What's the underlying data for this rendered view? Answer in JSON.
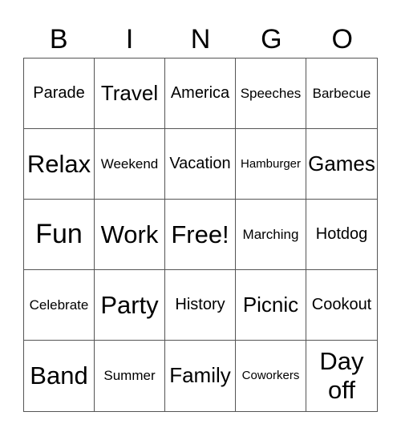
{
  "header": [
    "B",
    "I",
    "N",
    "G",
    "O"
  ],
  "cells": [
    {
      "text": "Parade",
      "size": "m"
    },
    {
      "text": "Travel",
      "size": "l"
    },
    {
      "text": "America",
      "size": "m"
    },
    {
      "text": "Speeches",
      "size": "s"
    },
    {
      "text": "Barbecue",
      "size": "s"
    },
    {
      "text": "Relax",
      "size": "xl"
    },
    {
      "text": "Weekend",
      "size": "s"
    },
    {
      "text": "Vacation",
      "size": "m"
    },
    {
      "text": "Hamburger",
      "size": "xs"
    },
    {
      "text": "Games",
      "size": "l"
    },
    {
      "text": "Fun",
      "size": "xxl"
    },
    {
      "text": "Work",
      "size": "xl"
    },
    {
      "text": "Free!",
      "size": "xl"
    },
    {
      "text": "Marching",
      "size": "s"
    },
    {
      "text": "Hotdog",
      "size": "m"
    },
    {
      "text": "Celebrate",
      "size": "s"
    },
    {
      "text": "Party",
      "size": "xl"
    },
    {
      "text": "History",
      "size": "m"
    },
    {
      "text": "Picnic",
      "size": "l"
    },
    {
      "text": "Cookout",
      "size": "m"
    },
    {
      "text": "Band",
      "size": "xl"
    },
    {
      "text": "Summer",
      "size": "s"
    },
    {
      "text": "Family",
      "size": "l"
    },
    {
      "text": "Coworkers",
      "size": "xs"
    },
    {
      "text": "Day off",
      "size": "xl"
    }
  ]
}
